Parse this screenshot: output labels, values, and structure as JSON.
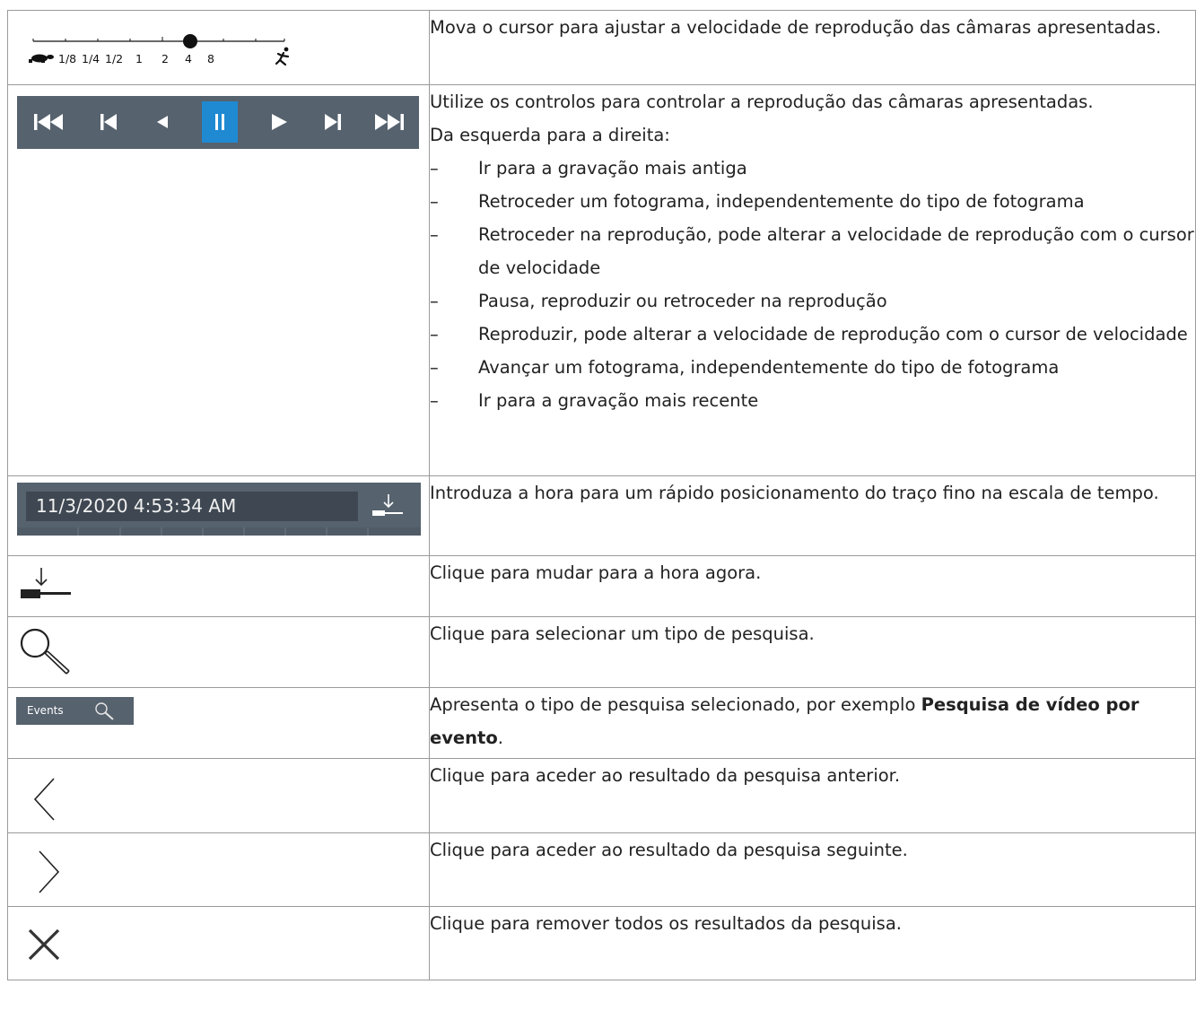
{
  "speed_labels": [
    "1/8",
    "1/4",
    "1/2",
    "1",
    "2",
    "4",
    "8"
  ],
  "time_field_value": "11/3/2020 4:53:34 AM",
  "events_label": "Events",
  "rows": {
    "speed": "Mova o cursor para ajustar a velocidade de reprodução das câmaras apresentadas.",
    "playback_intro_1": "Utilize os controlos para controlar a reprodução das câmaras apresentadas.",
    "playback_intro_2": "Da esquerda para a direita:",
    "dash": "–",
    "playback_items": [
      "Ir para a gravação mais antiga",
      "Retroceder um fotograma, independentemente do tipo de fotograma",
      "Retroceder na reprodução, pode alterar a velocidade de reprodução com o cursor de velocidade",
      "Pausa, reproduzir ou retroceder na reprodução",
      "Reproduzir, pode alterar a velocidade de reprodução com o cursor de velocidade",
      "Avançar um fotograma, independentemente do tipo de fotograma",
      "Ir para a gravação mais recente"
    ],
    "time": "Introduza a hora para um rápido posicionamento do traço fino na escala de tempo.",
    "now": "Clique para mudar para a hora agora.",
    "search": "Clique para selecionar um tipo de pesquisa.",
    "events_prefix": "Apresenta o tipo de pesquisa selecionado, por exemplo ",
    "events_bold": "Pesquisa de vídeo por evento",
    "events_suffix": ".",
    "prev": "Clique para aceder ao resultado da pesquisa anterior.",
    "next": "Clique para aceder ao resultado da pesquisa seguinte.",
    "clear": "Clique para remover todos os resultados da pesquisa."
  },
  "colors": {
    "bar": "#56626e",
    "active": "#1f8ad2",
    "border": "#9a9a9a"
  }
}
